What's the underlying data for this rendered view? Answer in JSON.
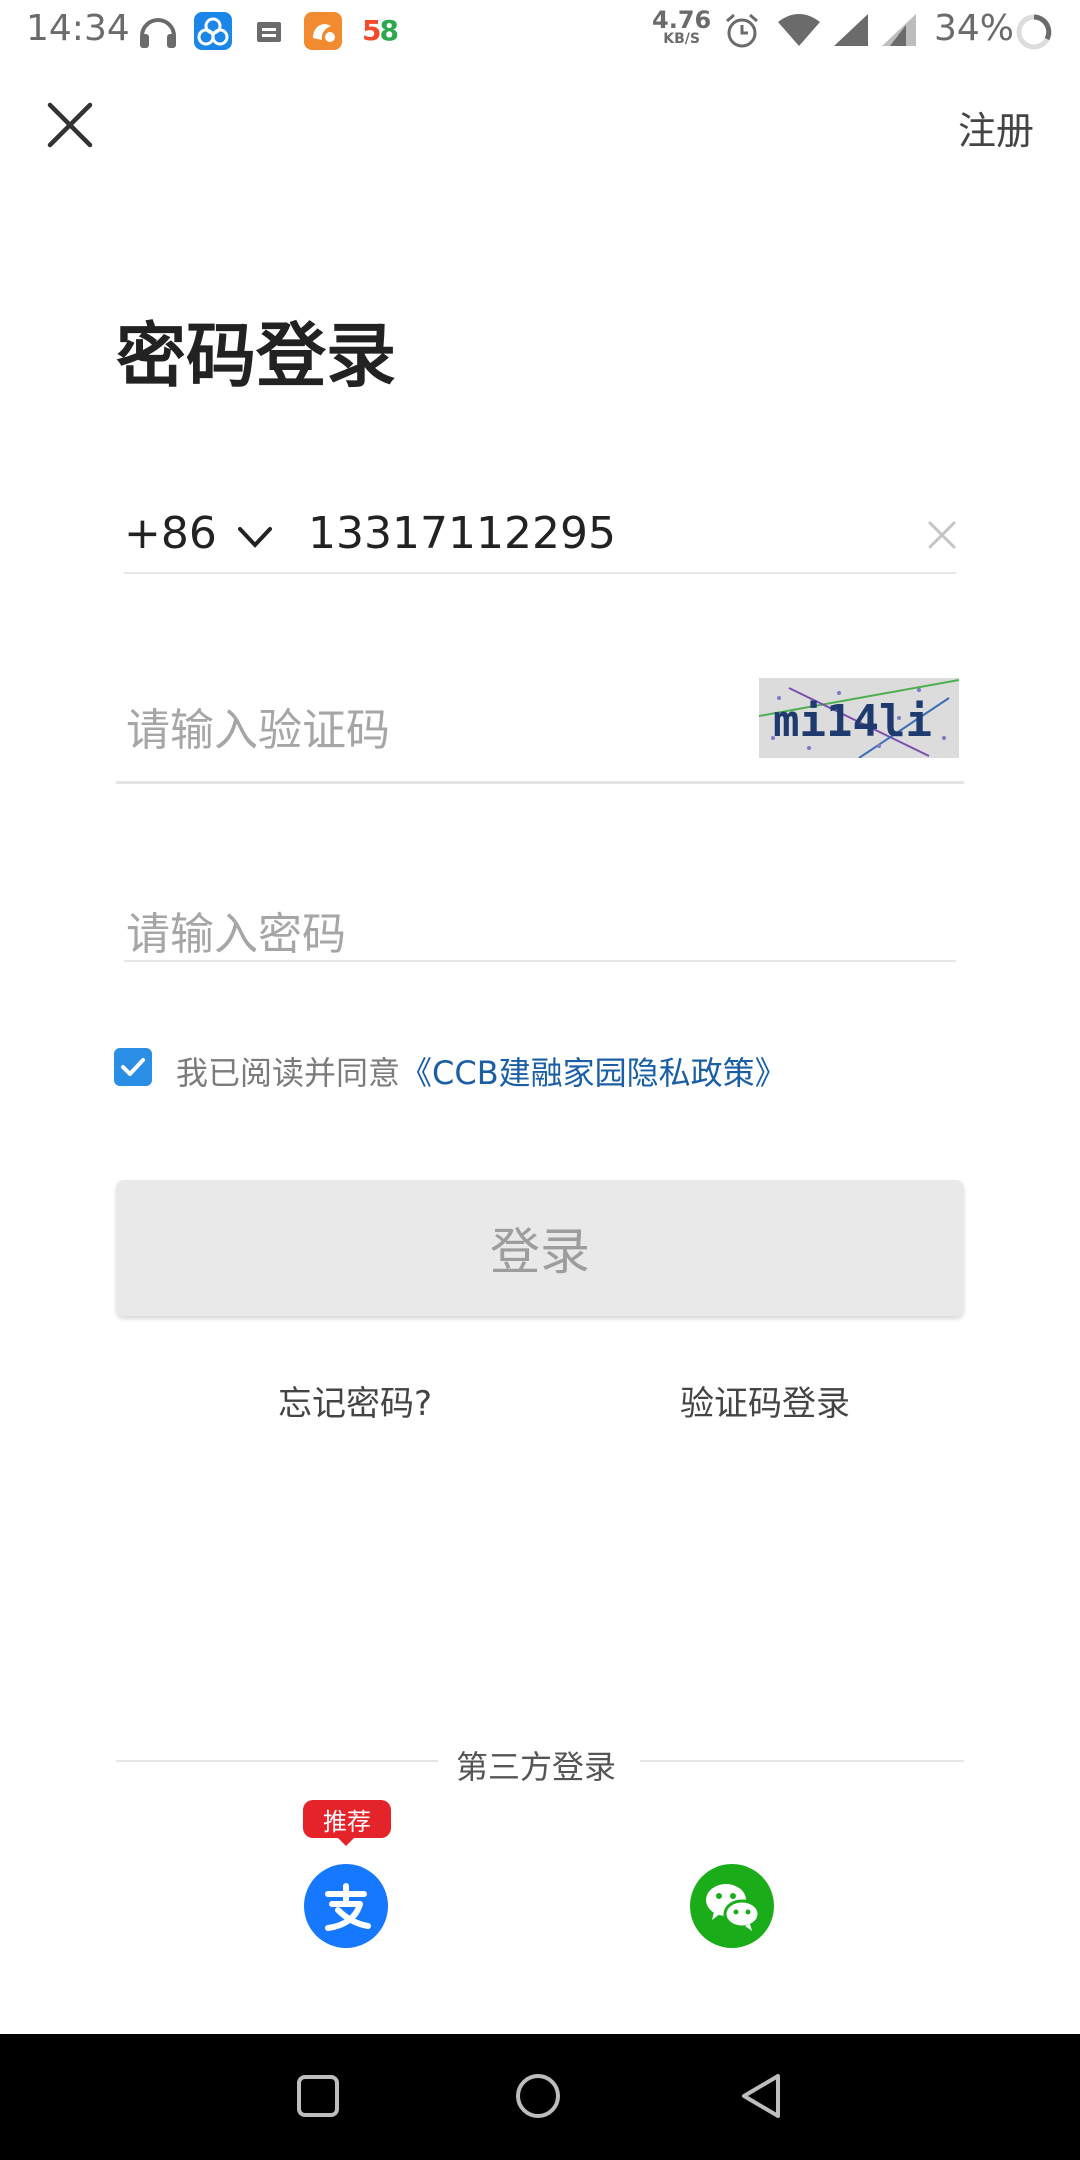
{
  "status_bar": {
    "time": "14:34",
    "network_speed": "4.76",
    "network_speed_unit": "KB/S",
    "battery": "34%",
    "icons": [
      "headset-icon",
      "app-triangle-icon",
      "inbox-icon",
      "uc-browser-icon",
      "app-58-icon",
      "alarm-icon",
      "wifi-icon",
      "signal-icon",
      "signal-2-icon",
      "battery-ring-icon"
    ],
    "app_58_label": "58"
  },
  "header": {
    "close_icon": "close-icon",
    "register_label": "注册"
  },
  "title": "密码登录",
  "phone": {
    "country_code": "+86",
    "value": "13317112295"
  },
  "captcha": {
    "placeholder": "请输入验证码",
    "image_text": "mi14li"
  },
  "password": {
    "placeholder": "请输入密码"
  },
  "agreement": {
    "checked": true,
    "text": "我已阅读并同意",
    "link_text": "《CCB建融家园隐私政策》",
    "link_color": "#1a5fa6"
  },
  "login_button": {
    "label": "登录"
  },
  "links": {
    "forgot_password": "忘记密码?",
    "sms_login": "验证码登录"
  },
  "third_party": {
    "label": "第三方登录",
    "recommend_badge": "推荐",
    "providers": [
      "alipay-icon",
      "wechat-icon"
    ]
  },
  "colors": {
    "accent_blue": "#2a8de6",
    "alipay": "#1677ff",
    "wechat": "#1aad19",
    "badge_red": "#e5232a"
  }
}
